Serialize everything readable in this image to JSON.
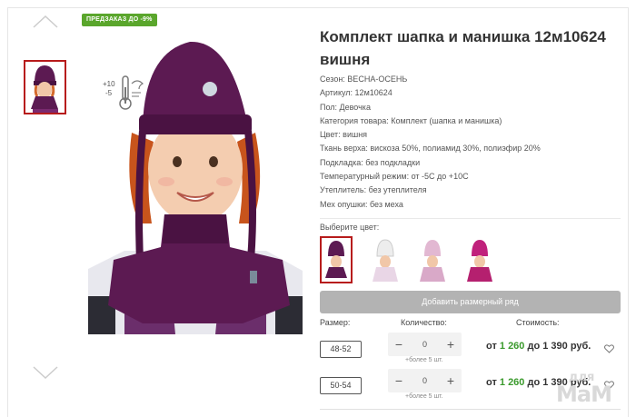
{
  "badge": "ПРЕДЗАКАЗ ДО -9%",
  "product": {
    "title": "Комплект шапка и манишка 12м10624 вишня",
    "specs": [
      "Сезон: ВЕСНА-ОСЕНЬ",
      "Артикул: 12м10624",
      "Пол: Девочка",
      "Категория товара: Комплект (шапка и манишка)",
      "Цвет: вишня",
      "Ткань верха: вискоза 50%, полиамид 30%, полиэфир 20%",
      "Подкладка: без подкладки",
      "Температурный режим: от -5С до +10С",
      "Утеплитель: без утеплителя",
      "Мех опушки: без меха"
    ]
  },
  "temp_icon": {
    "plus": "+10",
    "minus": "-5"
  },
  "color_label": "Выберите цвет:",
  "color_swatches": [
    {
      "name": "вишня",
      "hat": "#5c1a52",
      "selected": true
    },
    {
      "name": "white",
      "hat": "#ededed",
      "selected": false
    },
    {
      "name": "pink",
      "hat": "#e2b8d2",
      "selected": false
    },
    {
      "name": "magenta",
      "hat": "#c0217c",
      "selected": false
    }
  ],
  "add_button": "Добавить размерный ряд",
  "columns": {
    "size": "Размер:",
    "quantity": "Количество:",
    "cost": "Стоимость:"
  },
  "sizes": [
    {
      "size": "48-52",
      "qty": "0",
      "more": "+более 5 шт.",
      "price_from": "от ",
      "price_low": "1 260",
      "price_to": " до 1 390 руб."
    },
    {
      "size": "50-54",
      "qty": "0",
      "more": "+более 5 шт.",
      "price_from": "от ",
      "price_low": "1 260",
      "price_to": " до 1 390 руб."
    }
  ],
  "watermark": {
    "small": "для",
    "big": "МаМ"
  },
  "colors": {
    "accent_red": "#b71c1c",
    "green": "#3a9a2c",
    "badge_green": "#5aa62c",
    "hat_purple": "#5c1a52"
  }
}
